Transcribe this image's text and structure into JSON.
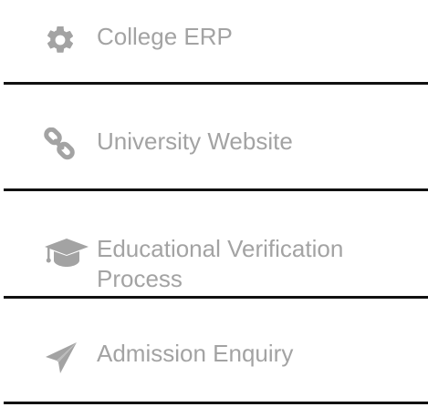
{
  "menu": {
    "items": [
      {
        "icon": "gear-icon",
        "label": "College ERP"
      },
      {
        "icon": "link-icon",
        "label": "University Website"
      },
      {
        "icon": "graduation-cap-icon",
        "label": "Educational Verification Process"
      },
      {
        "icon": "paper-plane-icon",
        "label": "Admission Enquiry"
      }
    ]
  },
  "colors": {
    "label": "#a3a3a3",
    "icon": "#a3a3a3",
    "divider": "#111111",
    "background": "#ffffff"
  }
}
